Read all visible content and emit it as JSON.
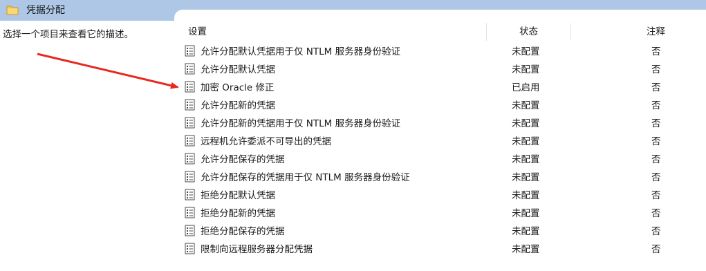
{
  "header": {
    "title": "凭据分配"
  },
  "description": "选择一个项目来查看它的描述。",
  "columns": {
    "setting": "设置",
    "state": "状态",
    "comment": "注释"
  },
  "rows": [
    {
      "name": "允许分配默认凭据用于仅 NTLM 服务器身份验证",
      "state": "未配置",
      "comment": "否"
    },
    {
      "name": "允许分配默认凭据",
      "state": "未配置",
      "comment": "否"
    },
    {
      "name": "加密 Oracle 修正",
      "state": "已启用",
      "comment": "否"
    },
    {
      "name": "允许分配新的凭据",
      "state": "未配置",
      "comment": "否"
    },
    {
      "name": "允许分配新的凭据用于仅 NTLM 服务器身份验证",
      "state": "未配置",
      "comment": "否"
    },
    {
      "name": "远程机允许委派不可导出的凭据",
      "state": "未配置",
      "comment": "否"
    },
    {
      "name": "允许分配保存的凭据",
      "state": "未配置",
      "comment": "否"
    },
    {
      "name": "允许分配保存的凭据用于仅 NTLM 服务器身份验证",
      "state": "未配置",
      "comment": "否"
    },
    {
      "name": "拒绝分配默认凭据",
      "state": "未配置",
      "comment": "否"
    },
    {
      "name": "拒绝分配新的凭据",
      "state": "未配置",
      "comment": "否"
    },
    {
      "name": "拒绝分配保存的凭据",
      "state": "未配置",
      "comment": "否"
    },
    {
      "name": "限制向远程服务器分配凭据",
      "state": "未配置",
      "comment": "否"
    }
  ],
  "icons": {
    "folder": "folder-icon",
    "policy": "policy-setting-icon"
  },
  "colors": {
    "header": "#aec7e6",
    "arrow": "#e8281e",
    "folder": "#f3c64b"
  }
}
